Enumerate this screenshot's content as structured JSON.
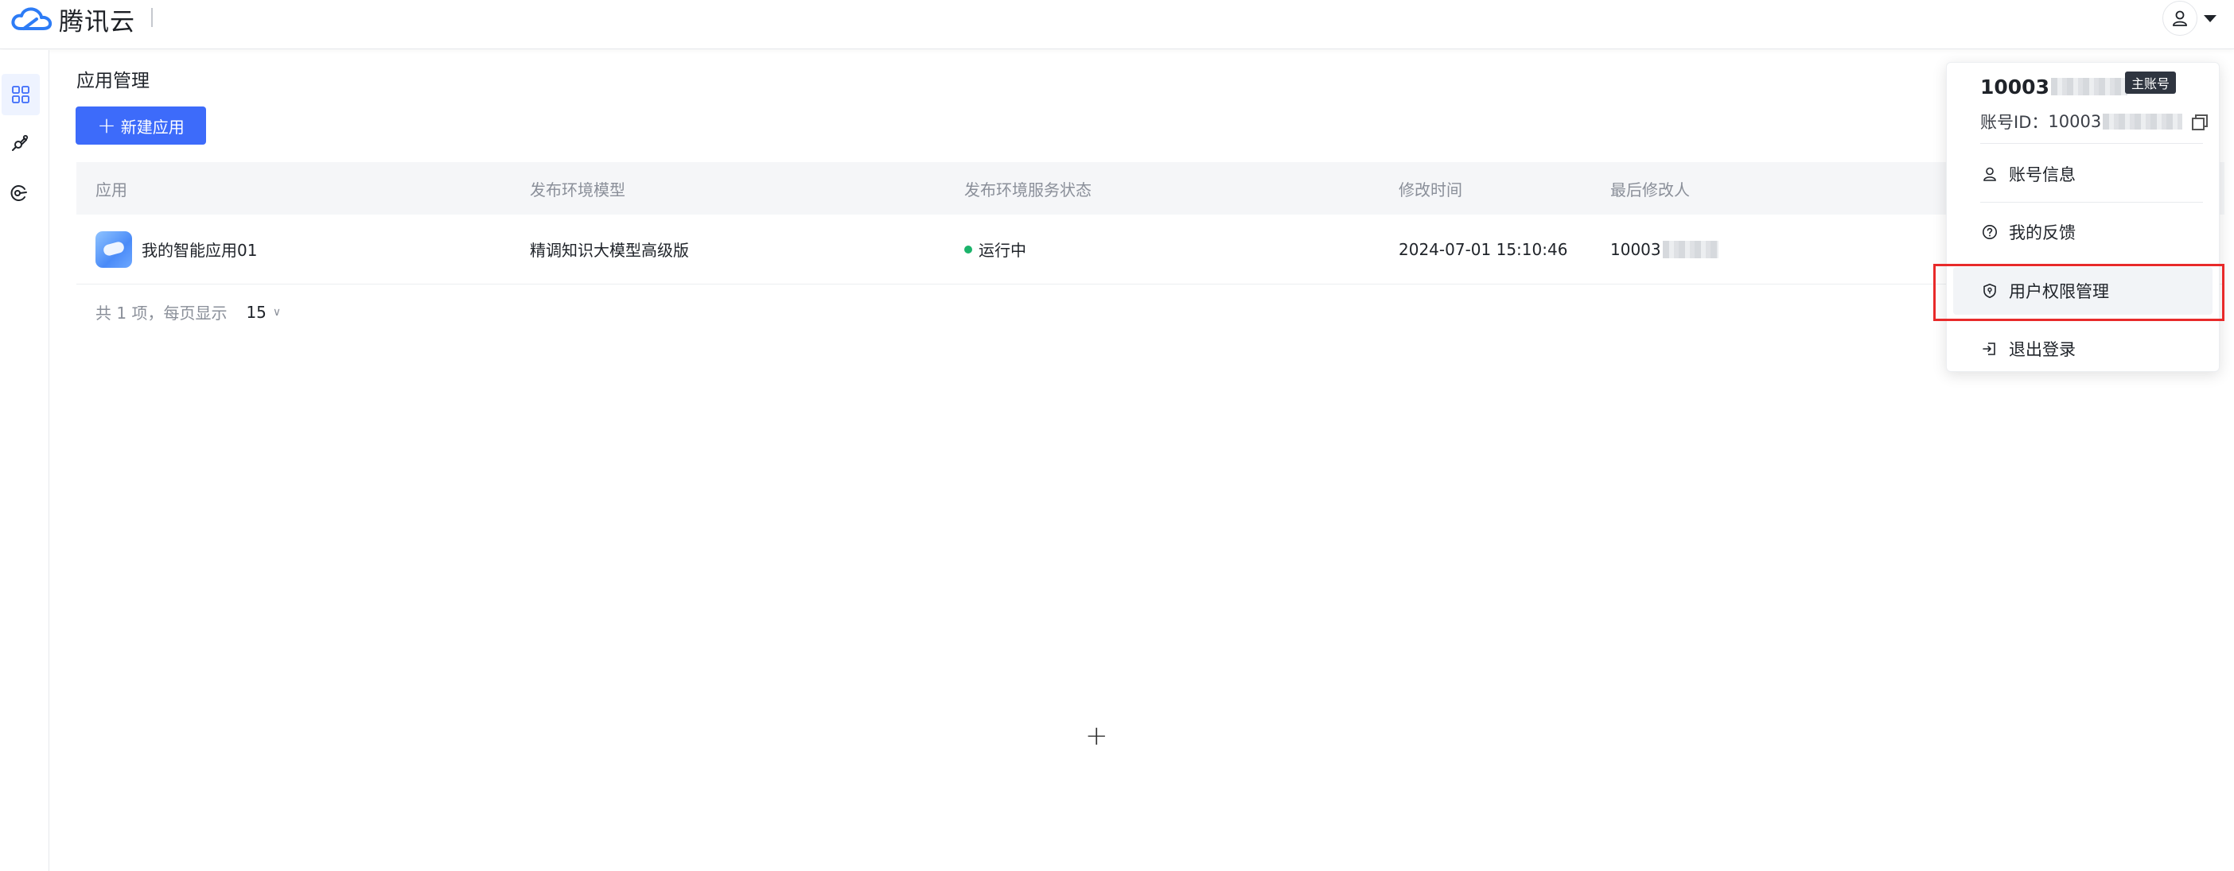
{
  "header": {
    "brand": "腾讯云",
    "user_icon": "user-icon",
    "caret_icon": "caret-down-icon",
    "brand_color": "#2d7cf6"
  },
  "sidebar": {
    "items": [
      {
        "icon": "grid-icon",
        "active": true
      },
      {
        "icon": "plug-icon",
        "active": false
      },
      {
        "icon": "orbit-icon",
        "active": false
      }
    ]
  },
  "main": {
    "title": "应用管理",
    "new_button": "新建应用",
    "accent_color": "#3d6bfa",
    "table": {
      "columns": [
        "应用",
        "发布环境模型",
        "发布环境服务状态",
        "修改时间",
        "最后修改人"
      ],
      "rows": [
        {
          "app": "我的智能应用01",
          "model": "精调知识大模型高级版",
          "status": "运行中",
          "status_color": "#1bb36b",
          "modified": "2024-07-01 15:10:46",
          "modifier": "10003"
        }
      ]
    },
    "pagination": {
      "summary": "共 1 项，每页显示",
      "page_size": "15"
    }
  },
  "account_menu": {
    "user_name": "10003",
    "badge": "主账号",
    "account_id_label": "账号ID：",
    "account_id": "10003",
    "items": [
      {
        "label": "账号信息",
        "icon": "user-icon"
      },
      {
        "label": "我的反馈",
        "icon": "question-circle-icon"
      },
      {
        "label": "用户权限管理",
        "icon": "shield-icon"
      },
      {
        "label": "退出登录",
        "icon": "logout-icon"
      }
    ],
    "highlight_color": "#e82a2a"
  }
}
